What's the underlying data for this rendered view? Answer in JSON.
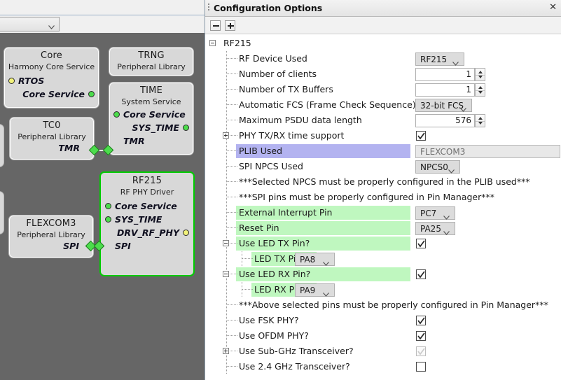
{
  "left_panel": {
    "toolbar_combo": {
      "value": "",
      "icon": "chevron-down-icon"
    },
    "canvas": {
      "nodes": [
        {
          "id": "core",
          "title": "Core",
          "subtitle": "Harmony Core Service",
          "ports": [
            {
              "label": "RTOS",
              "side": "left",
              "dot": "yellow"
            },
            {
              "label": "Core Service",
              "side": "right",
              "dot": "green"
            }
          ]
        },
        {
          "id": "trng",
          "title": "TRNG",
          "subtitle": "Peripheral Library",
          "ports": []
        },
        {
          "id": "time",
          "title": "TIME",
          "subtitle": "System Service",
          "ports": [
            {
              "label": "Core Service",
              "side": "left",
              "dot": "green"
            },
            {
              "label": "SYS_TIME",
              "side": "right",
              "dot": "green"
            },
            {
              "label": "TMR",
              "side": "left",
              "dot": "none"
            }
          ]
        },
        {
          "id": "tc0",
          "title": "TC0",
          "subtitle": "Peripheral Library",
          "ports": [
            {
              "label": "TMR",
              "side": "right",
              "dot": "none"
            }
          ]
        },
        {
          "id": "rf215",
          "title": "RF215",
          "subtitle": "RF PHY Driver",
          "selected": true,
          "ports": [
            {
              "label": "Core Service",
              "side": "left",
              "dot": "green"
            },
            {
              "label": "SYS_TIME",
              "side": "left",
              "dot": "green"
            },
            {
              "label": "DRV_RF_PHY",
              "side": "right",
              "dot": "yellow"
            },
            {
              "label": "SPI",
              "side": "left",
              "dot": "none"
            }
          ]
        },
        {
          "id": "flexcom3",
          "title": "FLEXCOM3",
          "subtitle": "Peripheral Library",
          "ports": [
            {
              "label": "SPI",
              "side": "right",
              "dot": "none"
            }
          ]
        }
      ]
    }
  },
  "config_window": {
    "title": "Configuration Options",
    "close_icon": "close-icon",
    "grip_icon": "drag-grip-icon",
    "toolbar": {
      "collapse_all": {
        "icon": "collapse-all-icon",
        "label": "−"
      },
      "expand_all": {
        "icon": "expand-all-icon",
        "label": "+"
      }
    },
    "tree": [
      {
        "id": "root",
        "label": "RF215",
        "depth": 0,
        "expander": "minus",
        "control": "none"
      },
      {
        "id": "rf_device_used",
        "label": "RF Device Used",
        "depth": 1,
        "expander": "none",
        "control": "select",
        "value": "RF215",
        "ctl_w": 70
      },
      {
        "id": "num_clients",
        "label": "Number of clients",
        "depth": 1,
        "expander": "none",
        "control": "spinner",
        "value": "1",
        "ctl_w": 100
      },
      {
        "id": "num_tx_buffers",
        "label": "Number of TX Buffers",
        "depth": 1,
        "expander": "none",
        "control": "spinner",
        "value": "1",
        "ctl_w": 100
      },
      {
        "id": "auto_fcs",
        "label": "Automatic FCS (Frame Check Sequence)",
        "depth": 1,
        "expander": "none",
        "control": "select",
        "value": "32-bit FCS",
        "ctl_w": 81
      },
      {
        "id": "max_psdu",
        "label": "Maximum PSDU data length",
        "depth": 1,
        "expander": "none",
        "control": "spinner",
        "value": "576",
        "ctl_w": 100
      },
      {
        "id": "phy_time",
        "label": "PHY TX/RX time support",
        "depth": 1,
        "expander": "plus",
        "control": "checkbox",
        "checked": true
      },
      {
        "id": "plib_used",
        "label": "PLIB Used",
        "depth": 1,
        "expander": "none",
        "control": "readonly",
        "value": "FLEXCOM3",
        "highlight": "sel",
        "ctl_w": 207
      },
      {
        "id": "spi_npcs",
        "label": "SPI NPCS Used",
        "depth": 1,
        "expander": "none",
        "control": "select",
        "value": "NPCS0",
        "ctl_w": 64
      },
      {
        "id": "note_npcs",
        "label": "***Selected NPCS must be properly configured in the PLIB used***",
        "depth": 1,
        "expander": "none",
        "control": "none"
      },
      {
        "id": "note_spi_pins",
        "label": "***SPI pins must be properly configured in Pin Manager***",
        "depth": 1,
        "expander": "none",
        "control": "none"
      },
      {
        "id": "ext_int_pin",
        "label": "External Interrupt Pin",
        "depth": 1,
        "expander": "none",
        "control": "select",
        "value": "PC7",
        "highlight": "green",
        "ctl_w": 57
      },
      {
        "id": "reset_pin",
        "label": "Reset Pin",
        "depth": 1,
        "expander": "none",
        "control": "select",
        "value": "PA25",
        "highlight": "green",
        "ctl_w": 57
      },
      {
        "id": "use_led_tx",
        "label": "Use LED TX Pin?",
        "depth": 1,
        "expander": "minus",
        "control": "checkbox",
        "checked": true,
        "highlight": "green"
      },
      {
        "id": "led_tx_pin",
        "label": "LED TX Pin",
        "depth": 2,
        "expander": "none",
        "control": "select",
        "value": "PA8",
        "highlight": "green",
        "hl_w": 93,
        "inline_ctl": 128,
        "ctl_w": 57
      },
      {
        "id": "use_led_rx",
        "label": "Use LED RX Pin?",
        "depth": 1,
        "expander": "minus",
        "control": "checkbox",
        "checked": true,
        "highlight": "green"
      },
      {
        "id": "led_rx_pin",
        "label": "LED RX Pin",
        "depth": 2,
        "expander": "none",
        "control": "select",
        "value": "PA9",
        "highlight": "green",
        "hl_w": 93,
        "inline_ctl": 128,
        "ctl_w": 57
      },
      {
        "id": "note_pins",
        "label": "***Above selected pins must be properly configured in Pin Manager***",
        "depth": 1,
        "expander": "none",
        "control": "none"
      },
      {
        "id": "use_fsk",
        "label": "Use FSK PHY?",
        "depth": 1,
        "expander": "none",
        "control": "checkbox",
        "checked": true
      },
      {
        "id": "use_ofdm",
        "label": "Use OFDM PHY?",
        "depth": 1,
        "expander": "none",
        "control": "checkbox",
        "checked": true
      },
      {
        "id": "use_subghz",
        "label": "Use Sub-GHz Transceiver?",
        "depth": 1,
        "expander": "plus",
        "control": "checkbox",
        "checked": true,
        "disabled": true
      },
      {
        "id": "use_24ghz",
        "label": "Use 2.4 GHz Transceiver?",
        "depth": 1,
        "expander": "none",
        "control": "checkbox",
        "checked": false
      }
    ]
  },
  "colors": {
    "selection": "#b3b3f0",
    "green_highlight": "#bff7bf",
    "canvas_bg": "#666666",
    "node_bg": "#d8d8d8",
    "node_selected_border": "#00cc00",
    "port_green": "#4cdc4c",
    "port_yellow": "#f2f27a"
  }
}
